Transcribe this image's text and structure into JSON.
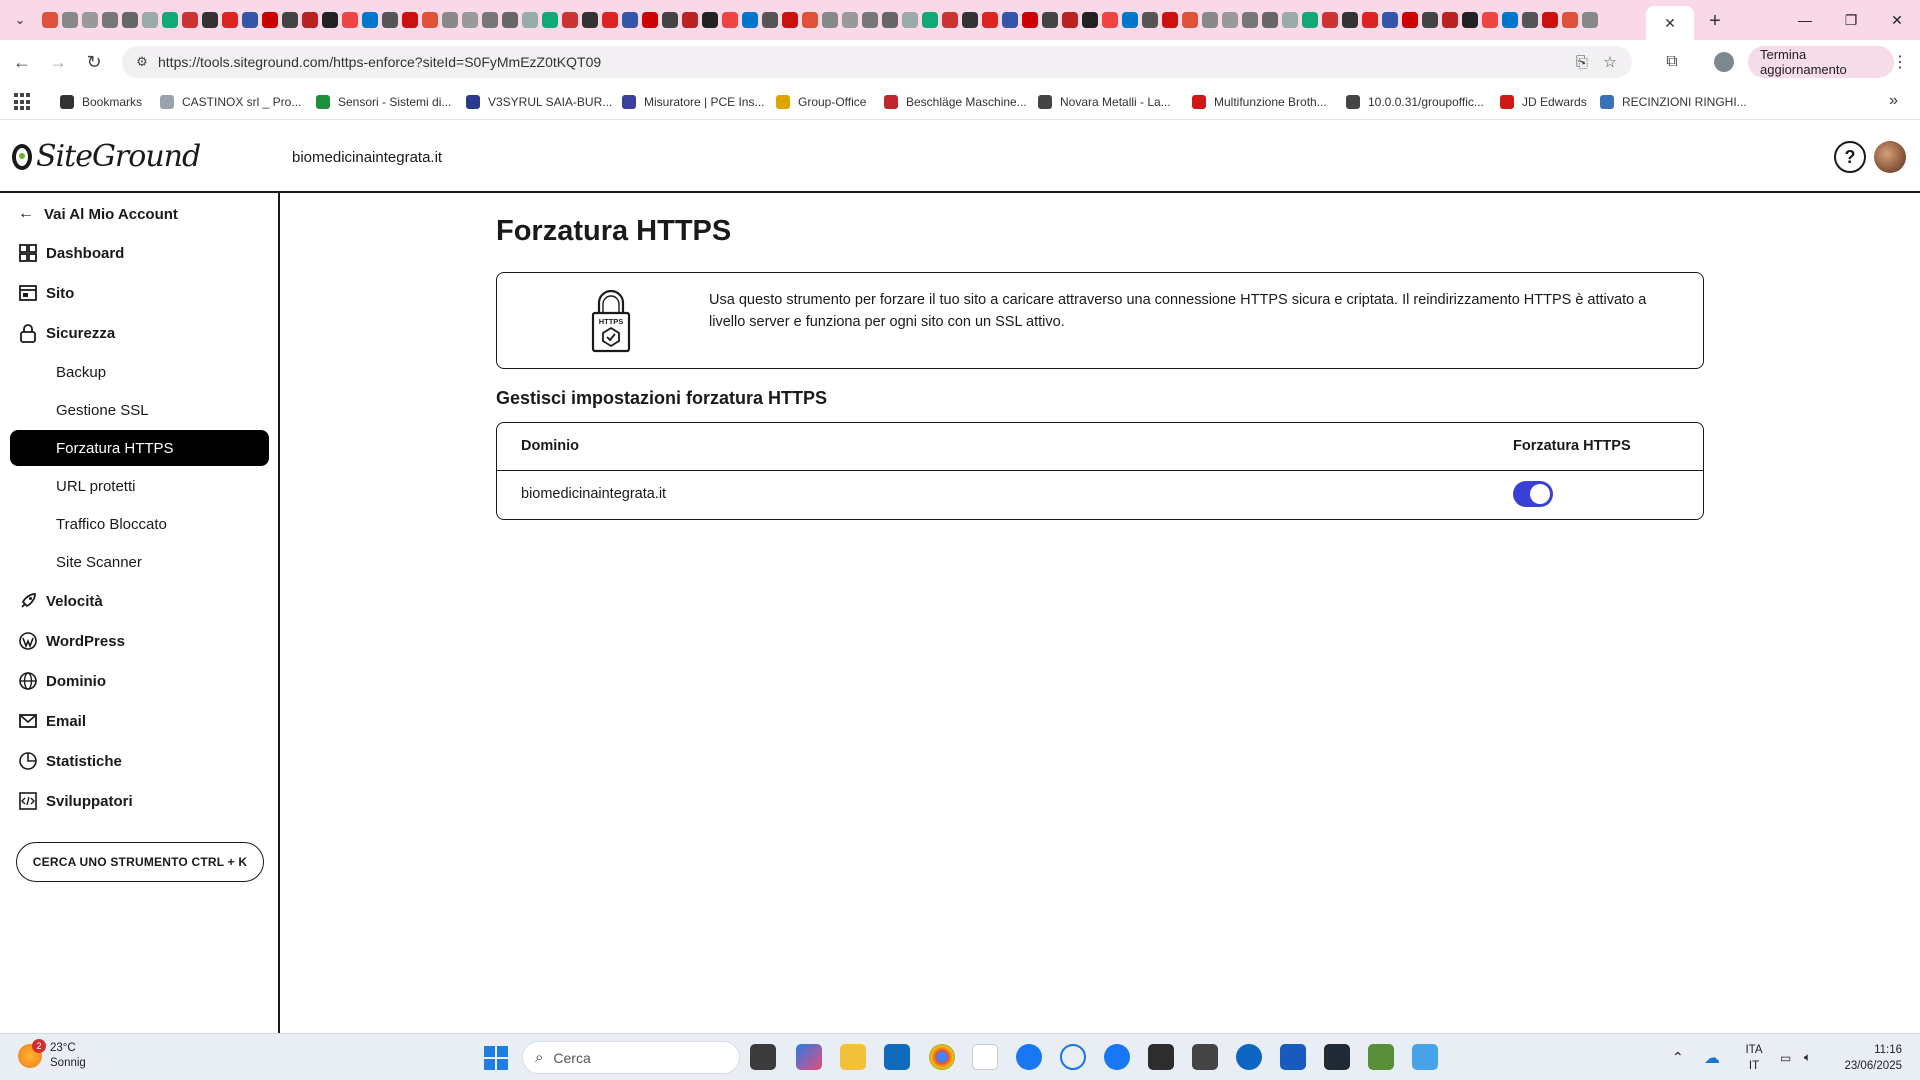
{
  "browser": {
    "url": "https://tools.siteground.com/https-enforce?siteId=S0FyMmEzZ0tKQT09",
    "update_label": "Termina aggiornamento",
    "bookmarks": [
      {
        "label": "Bookmarks",
        "color": "#333333"
      },
      {
        "label": "CASTINOX srl _ Pro...",
        "color": "#9aa3ad"
      },
      {
        "label": "Sensori - Sistemi di...",
        "color": "#1e8f3a"
      },
      {
        "label": "V3SYRUL SAIA-BUR...",
        "color": "#2b3a8c"
      },
      {
        "label": "Misuratore | PCE Ins...",
        "color": "#3b3f9e"
      },
      {
        "label": "Group-Office",
        "color": "#e0a400"
      },
      {
        "label": "Beschläge Maschine...",
        "color": "#c0262d"
      },
      {
        "label": "Novara Metalli - La...",
        "color": "#444444"
      },
      {
        "label": "Multifunzione Broth...",
        "color": "#d01818"
      },
      {
        "label": "10.0.0.31/groupoffic...",
        "color": "#444444"
      },
      {
        "label": "JD Edwards",
        "color": "#d01818"
      },
      {
        "label": "RECINZIONI RINGHI...",
        "color": "#3b6fb6"
      }
    ]
  },
  "header": {
    "logo_text": "SiteGround",
    "site_domain": "biomedicinaintegrata.it"
  },
  "sidebar": {
    "back_label": "Vai Al Mio Account",
    "items": [
      {
        "label": "Dashboard",
        "icon": "dashboard-icon"
      },
      {
        "label": "Sito",
        "icon": "site-icon"
      },
      {
        "label": "Sicurezza",
        "icon": "lock-icon"
      }
    ],
    "security_sub": [
      {
        "label": "Backup",
        "active": false
      },
      {
        "label": "Gestione SSL",
        "active": false
      },
      {
        "label": "Forzatura HTTPS",
        "active": true
      },
      {
        "label": "URL protetti",
        "active": false
      },
      {
        "label": "Traffico Bloccato",
        "active": false
      },
      {
        "label": "Site Scanner",
        "active": false
      }
    ],
    "items_after": [
      {
        "label": "Velocità",
        "icon": "rocket-icon"
      },
      {
        "label": "WordPress",
        "icon": "wordpress-icon"
      },
      {
        "label": "Dominio",
        "icon": "globe-icon"
      },
      {
        "label": "Email",
        "icon": "mail-icon"
      },
      {
        "label": "Statistiche",
        "icon": "chart-icon"
      },
      {
        "label": "Sviluppatori",
        "icon": "code-icon"
      }
    ],
    "search_tool_label": "CERCA UNO STRUMENTO CTRL + K"
  },
  "main": {
    "title": "Forzatura HTTPS",
    "info_icon_label": "HTTPS",
    "info_text": "Usa questo strumento per forzare il tuo sito a caricare attraverso una connessione HTTPS sicura e criptata. Il reindirizzamento HTTPS è attivato a livello server e funziona per ogni sito con un SSL attivo.",
    "section_title": "Gestisci impostazioni forzatura HTTPS",
    "table": {
      "col_domain": "Dominio",
      "col_https": "Forzatura HTTPS",
      "rows": [
        {
          "domain": "biomedicinaintegrata.it",
          "https_enabled": true
        }
      ]
    },
    "accent_color": "#3a3fd6"
  },
  "taskbar": {
    "weather_temp": "23°C",
    "weather_desc": "Sonnig",
    "weather_badge": "2",
    "search_placeholder": "Cerca",
    "lang_top": "ITA",
    "lang_bottom": "IT",
    "time": "11:16",
    "date": "23/06/2025"
  }
}
